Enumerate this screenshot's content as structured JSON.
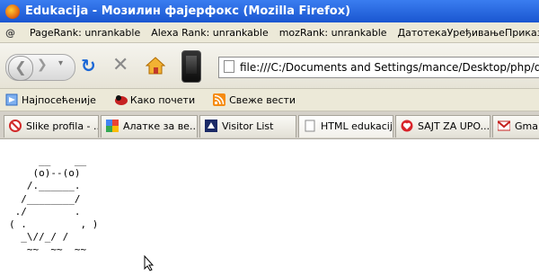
{
  "window": {
    "title": "Edukacija - Мозилин фајерфокс (Mozilla Firefox)"
  },
  "toolbar2": {
    "items": [
      "PageRank: unrankable",
      "Alexa Rank: unrankable",
      "mozRank: unrankable",
      "Датотека",
      "Уређивање",
      "Приказ"
    ]
  },
  "nav": {
    "url": "file:///C:/Documents and Settings/mance/Desktop/php/diazajn za no"
  },
  "bookmarks": [
    {
      "label": "Најпосећеније"
    },
    {
      "label": "Како почети"
    },
    {
      "label": "Свеже вести"
    }
  ],
  "tabs": [
    {
      "label": "Slike profila - ..."
    },
    {
      "label": "Алатке за ве..."
    },
    {
      "label": "Visitor List"
    },
    {
      "label": "HTML edukacija"
    },
    {
      "label": "SAJT ZA UPO..."
    },
    {
      "label": "Gmail"
    }
  ],
  "content": {
    "ascii_art": "     __    __\n    (o)--(o)\n   /.______.\n  /________/\n ./        .\n( .         , )\n  _\\//_/ /\n   ~~  ~~  ~~"
  }
}
